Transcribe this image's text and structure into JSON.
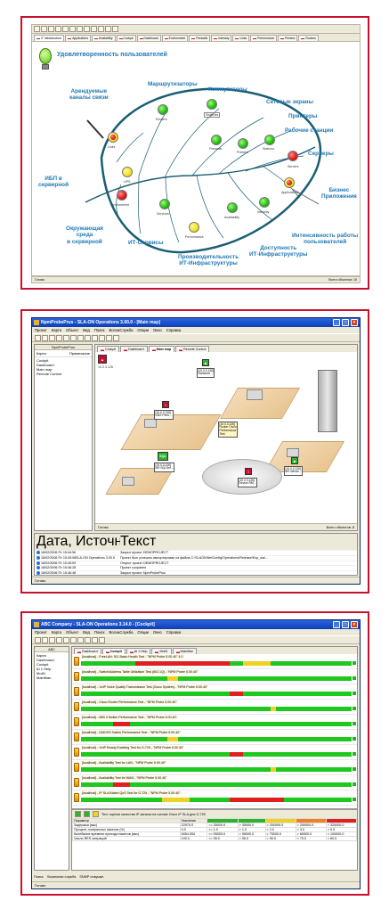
{
  "shot1": {
    "tabs": [
      "IT Infrastructure",
      "Applications",
      "Availability",
      "Cockpit",
      "Dashboard",
      "Environment",
      "Firewalls",
      "Intensity",
      "Links",
      "Performance",
      "Printers",
      "Routers"
    ],
    "header_title": "Удовлетворенность пользователей",
    "labels": {
      "lease": "Арендуемые\nканалы связи",
      "routers": "Маршрутизаторы",
      "switches": "Коммутаторы",
      "firewalls": "Сетевые экраны",
      "printers": "Принтеры",
      "workstations": "Рабочие станции",
      "servers": "Серверы",
      "ups": "ИБП в\nсерверной",
      "business_apps": "Бизнес\nПриложения",
      "environment": "Окружающая\nсреда\nв серверной",
      "it_services": "ИТ-Сервисы",
      "intensity": "Интенсивность работы\nпользователей",
      "availability": "Доступность\nИТ-Инфраструктуры",
      "performance": "Производительность\nИТ-Инфраструктуры"
    },
    "nodes": {
      "links": "Links",
      "routers": "Routers",
      "switches": "Switches",
      "firewalls": "Firewalls",
      "printers": "Printers",
      "stations": "Stations",
      "servers": "Servers",
      "ups": "UPS",
      "environment": "Environment",
      "services": "Services",
      "performance": "Performance",
      "availability": "Availability",
      "intensity": "Intensity",
      "applications": "Applications"
    },
    "status_left": "Готово",
    "status_right": "Всего объектов: 15"
  },
  "shot2": {
    "title": "NpmProbePrus - SLA-ON Operations 3.00.0 - [Main map]",
    "menu": [
      "Проект",
      "Карта",
      "Объект",
      "Вид",
      "Поиск",
      "ВоснаСлужба",
      "Опции",
      "Окно",
      "Справка"
    ],
    "side_header": "NpmProbePrus",
    "nav_col1": "Карта",
    "nav_col2": "Примечание",
    "nav_items": [
      "Cockpit",
      "Dashboard",
      "Main map",
      "Remote Control"
    ],
    "tabs": [
      "Cockpit",
      "Dashboard",
      "Main map",
      "Remote Control"
    ],
    "map": {
      "n1": "[10.0.3.126]\nSwitched ...",
      "n2": "[10.0.3.126]\nDNS Perfo...",
      "n3": "[10.0.3.126]\nRouter Cisco\nPerformance\nTest",
      "n4": "[10.0.3.126]\nMS SQLSer...",
      "n5": "[10.0.3.126]\nDevice RM...",
      "n6": "[10.0.3.126]\nMS Windo...",
      "top_left": "10.0.3.126"
    },
    "status_left": "Готово",
    "status_right": "Всего объектов: 8",
    "log_headers": [
      "Дата, время",
      "Источник",
      "Текст"
    ],
    "log_rows": [
      [
        "18/02/2006 Пт 15:44:56",
        "",
        "Закрыт проект DEMOPROJECT"
      ],
      [
        "18/02/2006 Пт 15:45:08",
        "SLA-ON Operations 3.00.0",
        "Проект был успешно импортирован из файла C:\\SLAON\\NetConfig\\Operations\\Release\\Exp_sla\\..."
      ],
      [
        "18/02/2006 Пт 15:45:09",
        "",
        "Открыт проект DEMOPROJECT"
      ],
      [
        "18/02/2006 Пт 15:46:28",
        "",
        "Проект сохранен"
      ],
      [
        "18/02/2006 Пт 15:46:48",
        "",
        "Закрыт проект NpmProbePrus"
      ]
    ],
    "bottom": "Готово"
  },
  "shot3": {
    "title": "ABC Company - SLA-ON Operations 3.14.0 - [Cockpit]",
    "menu": [
      "Проект",
      "Карта",
      "Объект",
      "Вид",
      "Поиск",
      "ВоснаСлужба",
      "Опции",
      "Окно",
      "Справка"
    ],
    "side_header": "ABC",
    "nav_items": [
      "Карта",
      "Dashboard",
      "Cockpit",
      "Ш 1 Help",
      "Мой1",
      "MainMan"
    ],
    "tabs": [
      "Dashboard",
      "Cockpit",
      "Ш 1 Help",
      "Мой1",
      "MainMan"
    ],
    "tests": [
      "[localhost] - FreeLAN: 911 Basic Health Test - \"NPM Probe 5.00.40\" 4.0",
      "[localhost] - Switch/Address Table Utilization Test (802.1Q) - \"NPM Probe 5.00.40\"",
      "[localhost] - VoIP Voice Quality Transmission Test (Cisco System) - \"NPM Probe 5.00.40\"",
      "[localhost] - Cisco Router Performance Test - \"NPM Probe 5.00.40\"",
      "[localhost] - MIB II Switch Performance Test - \"NPM Probe 5.00.40\"",
      "[localhost] - DMOVS Switch Performance Test - \"NPM Probe 5.00.40\"",
      "[localhost] - VoIP Ready Enabling Test for G.729 - \"NPM Probe 5.00.40\"",
      "[localhost] - Availability Test for LAN - \"NPM Probe 5.00.40\"",
      "[localhost] - Availability Test for WAN - \"NPM Probe 5.00.40\"",
      "[localhost] - IP SLA Based QoS Test for G.729 - \"NPM Probe 5.00.40\""
    ],
    "detail_title": "Тест оценки качества IP-канала на основе Cisco IP SLA для G.729",
    "table_headers": [
      "Параметр",
      "Значение",
      "",
      "",
      "",
      "",
      ""
    ],
    "table_rows": [
      [
        "Задержка (мкс)",
        "22970.0",
        "<= 35000.0",
        "> 35000.0",
        "> 200000.0",
        "> 250000.0",
        "> 320000.0"
      ],
      [
        "Процент потерянных пакетов (%)",
        "0.0",
        "<= 1.0",
        "> 1.0",
        "> 2.0",
        "> 3.0",
        "> 5.0"
      ],
      [
        "Колебание времени прихода пакетов (мкс)",
        "6054.054",
        "<= 55000.0",
        "> 55000.0",
        "> 75000.0",
        "> 60000.0",
        "> 100000.0"
      ],
      [
        "Число RES операций",
        "100.0",
        "<= 95.0",
        "< 95.0",
        "< 90.0",
        "< 70.0",
        "< 60.0"
      ]
    ],
    "bottom_tabs": [
      "Поиск",
      "Локальная служба",
      "SNMP ловушки"
    ],
    "bottom": "Готово"
  }
}
